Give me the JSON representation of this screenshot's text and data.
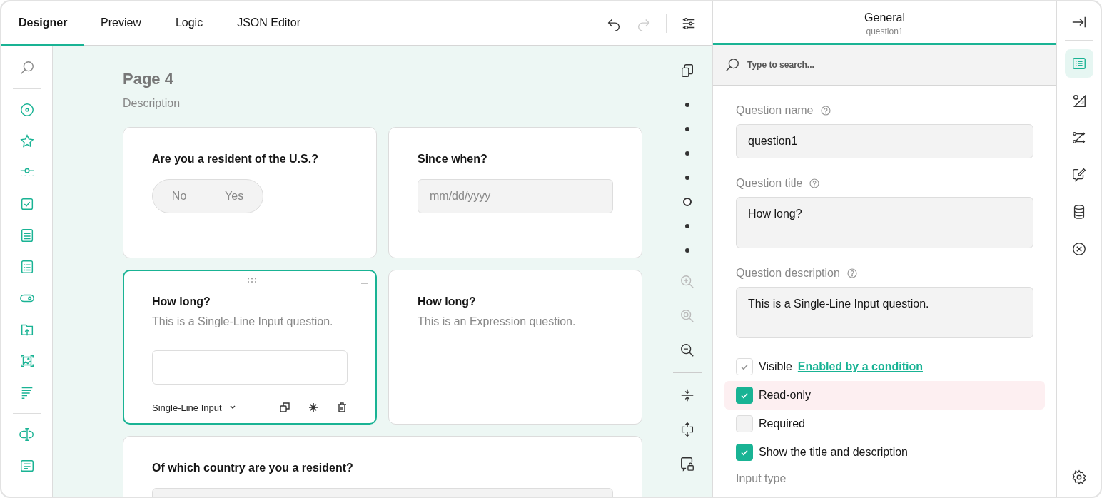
{
  "tabs": [
    {
      "label": "Designer",
      "selected": true
    },
    {
      "label": "Preview",
      "selected": false
    },
    {
      "label": "Logic",
      "selected": false
    },
    {
      "label": "JSON Editor",
      "selected": false
    }
  ],
  "toolbar": [
    {
      "kind": "undo",
      "disabled": false
    },
    {
      "kind": "redo",
      "disabled": true
    },
    {
      "kind": "settings",
      "disabled": false
    }
  ],
  "page": {
    "title": "Page 4",
    "description": "Description"
  },
  "cards": [
    {
      "kind": "boolean",
      "title": "Are you a resident of the U.S.?",
      "selected": false,
      "labels": [
        "No",
        "Yes"
      ]
    },
    {
      "kind": "date",
      "title": "Since when?",
      "placeholder": "mm/dd/yyyy",
      "selected": false
    },
    {
      "kind": "text",
      "title": "How long?",
      "description": "This is a Single-Line Input question.",
      "selected": true,
      "type_label": "Single-Line Input"
    },
    {
      "kind": "expression",
      "title": "How long?",
      "description": "This is an Expression question.",
      "selected": false
    },
    {
      "kind": "dropdown",
      "title": "Of which country are you a resident?",
      "selected": false
    }
  ],
  "page_navigator": [
    {
      "selected": false
    },
    {
      "selected": false
    },
    {
      "selected": false
    },
    {
      "selected": false
    },
    {
      "selected": true
    },
    {
      "selected": false
    },
    {
      "selected": false
    }
  ],
  "canvas_tools": [
    {
      "kind": "zoom-in",
      "disabled": true
    },
    {
      "kind": "zoom-reset",
      "disabled": true
    },
    {
      "kind": "zoom-out",
      "disabled": false
    },
    {
      "kind": "collapse-all",
      "disabled": false
    },
    {
      "kind": "expand-all",
      "disabled": false
    },
    {
      "kind": "lock",
      "disabled": false
    }
  ],
  "property_grid": {
    "title": "General",
    "subtitle": "question1",
    "search": {
      "placeholder": "Type to search..."
    },
    "fields": [
      {
        "kind": "text",
        "label": "Question name",
        "value": "question1"
      },
      {
        "kind": "textarea",
        "label": "Question title",
        "value": "How long?"
      },
      {
        "kind": "textarea",
        "label": "Question description",
        "value": "This is a Single-Line Input question."
      }
    ],
    "checkboxes": [
      {
        "label": "Visible",
        "checked": true,
        "disabled": true,
        "highlighted": false,
        "link": "Enabled by a condition"
      },
      {
        "label": "Read-only",
        "checked": true,
        "disabled": false,
        "highlighted": true
      },
      {
        "label": "Required",
        "checked": false,
        "disabled": false,
        "highlighted": false
      },
      {
        "label": "Show the title and description",
        "checked": true,
        "disabled": false,
        "highlighted": false
      }
    ],
    "next_label": "Input type"
  },
  "side_tabs": [
    {
      "kind": "general",
      "selected": true
    },
    {
      "kind": "theme",
      "selected": false
    },
    {
      "kind": "logic",
      "selected": false
    },
    {
      "kind": "validation",
      "selected": false
    },
    {
      "kind": "data",
      "selected": false
    },
    {
      "kind": "clear",
      "selected": false
    }
  ]
}
